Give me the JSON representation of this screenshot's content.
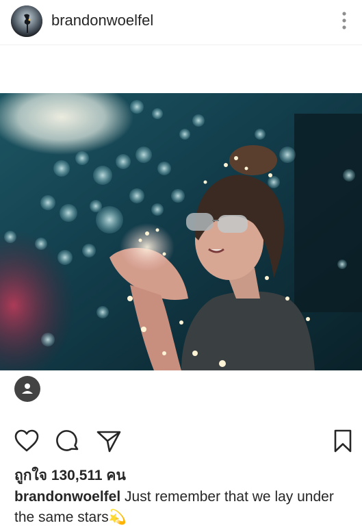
{
  "post": {
    "username": "brandonwoelfel",
    "likes_text": "ถูกใจ 130,511 คน",
    "caption_text": "Just remember that we lay under the same stars",
    "caption_emoji": "💫"
  },
  "icons": {
    "avatar": "profile-avatar",
    "more": "more-vertical-icon",
    "tag": "person-tag-icon",
    "like": "heart-icon",
    "comment": "comment-icon",
    "share": "send-icon",
    "save": "bookmark-icon"
  },
  "colors": {
    "text": "#262626",
    "divider": "#efefef",
    "tag_badge": "#434343",
    "photo_bg": "#0f3340"
  }
}
